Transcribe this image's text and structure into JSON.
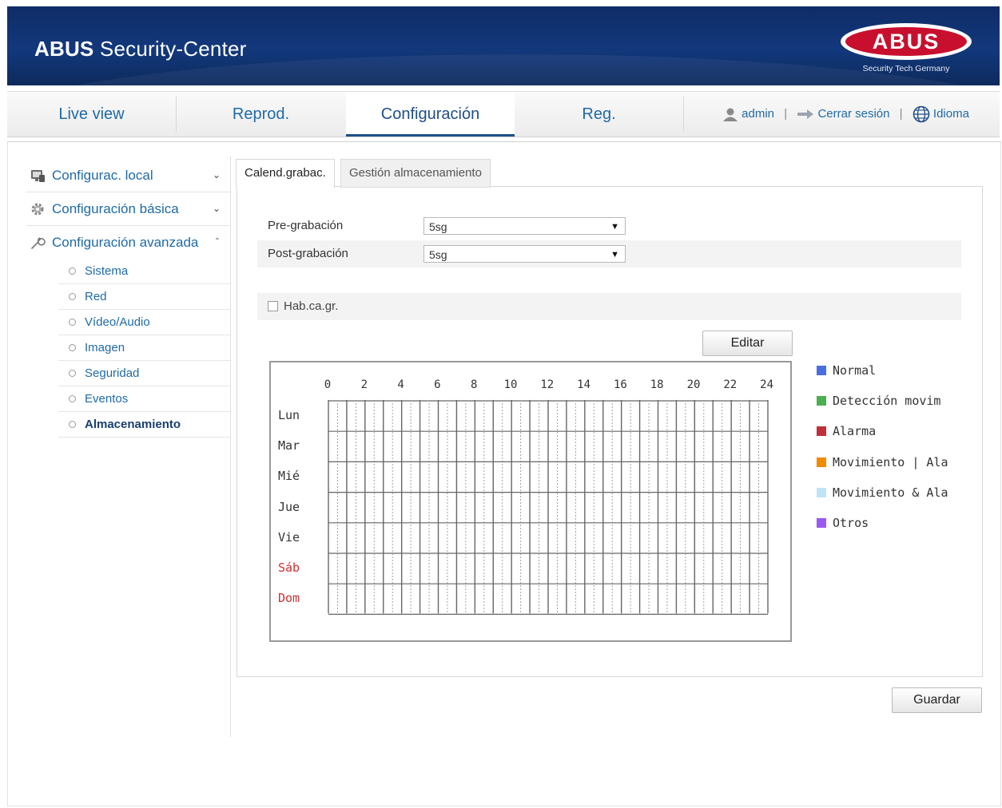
{
  "header": {
    "brand": "ABUS",
    "product": "Security-Center",
    "logo_text": "ABUS",
    "logo_tagline": "Security Tech Germany"
  },
  "nav": {
    "tabs": [
      {
        "label": "Live view",
        "active": false
      },
      {
        "label": "Reprod.",
        "active": false
      },
      {
        "label": "Configuración",
        "active": true
      },
      {
        "label": "Reg.",
        "active": false
      }
    ],
    "user": "admin",
    "logout": "Cerrar sesión",
    "language": "Idioma"
  },
  "sidebar": {
    "sections": [
      {
        "label": "Configurac. local",
        "icon": "monitor-icon",
        "expanded": false
      },
      {
        "label": "Configuración básica",
        "icon": "gear-icon",
        "expanded": false
      },
      {
        "label": "Configuración avanzada",
        "icon": "wrench-icon",
        "expanded": true
      }
    ],
    "subitems": [
      {
        "label": "Sistema"
      },
      {
        "label": "Red"
      },
      {
        "label": "Vídeo/Audio"
      },
      {
        "label": "Imagen"
      },
      {
        "label": "Seguridad"
      },
      {
        "label": "Eventos"
      },
      {
        "label": "Almacenamiento",
        "active": true
      }
    ]
  },
  "content": {
    "tabs": [
      {
        "label": "Calend.grabac.",
        "active": true
      },
      {
        "label": "Gestión almacenamiento",
        "active": false
      }
    ],
    "pre_label": "Pre-grabación",
    "pre_value": "5sg",
    "post_label": "Post-grabación",
    "post_value": "5sg",
    "enable_label": "Hab.ca.gr.",
    "enable_checked": false,
    "edit_button": "Editar",
    "save_button": "Guardar"
  },
  "schedule": {
    "hour_labels": [
      "0",
      "2",
      "4",
      "6",
      "8",
      "10",
      "12",
      "14",
      "16",
      "18",
      "20",
      "22",
      "24"
    ],
    "days": [
      {
        "label": "Lun",
        "weekend": false
      },
      {
        "label": "Mar",
        "weekend": false
      },
      {
        "label": "Mié",
        "weekend": false
      },
      {
        "label": "Jue",
        "weekend": false
      },
      {
        "label": "Vie",
        "weekend": false
      },
      {
        "label": "Sáb",
        "weekend": true
      },
      {
        "label": "Dom",
        "weekend": true
      }
    ],
    "weekend_color": "#d43030"
  },
  "legend": [
    {
      "label": "Normal",
      "color": "#4a6ee0"
    },
    {
      "label": "Detección movim",
      "color": "#4caf50"
    },
    {
      "label": "Alarma",
      "color": "#c0303a"
    },
    {
      "label": "Movimiento | Ala",
      "color": "#f08c00"
    },
    {
      "label": "Movimiento & Ala",
      "color": "#bfe3f5"
    },
    {
      "label": "Otros",
      "color": "#9b59f0"
    }
  ]
}
